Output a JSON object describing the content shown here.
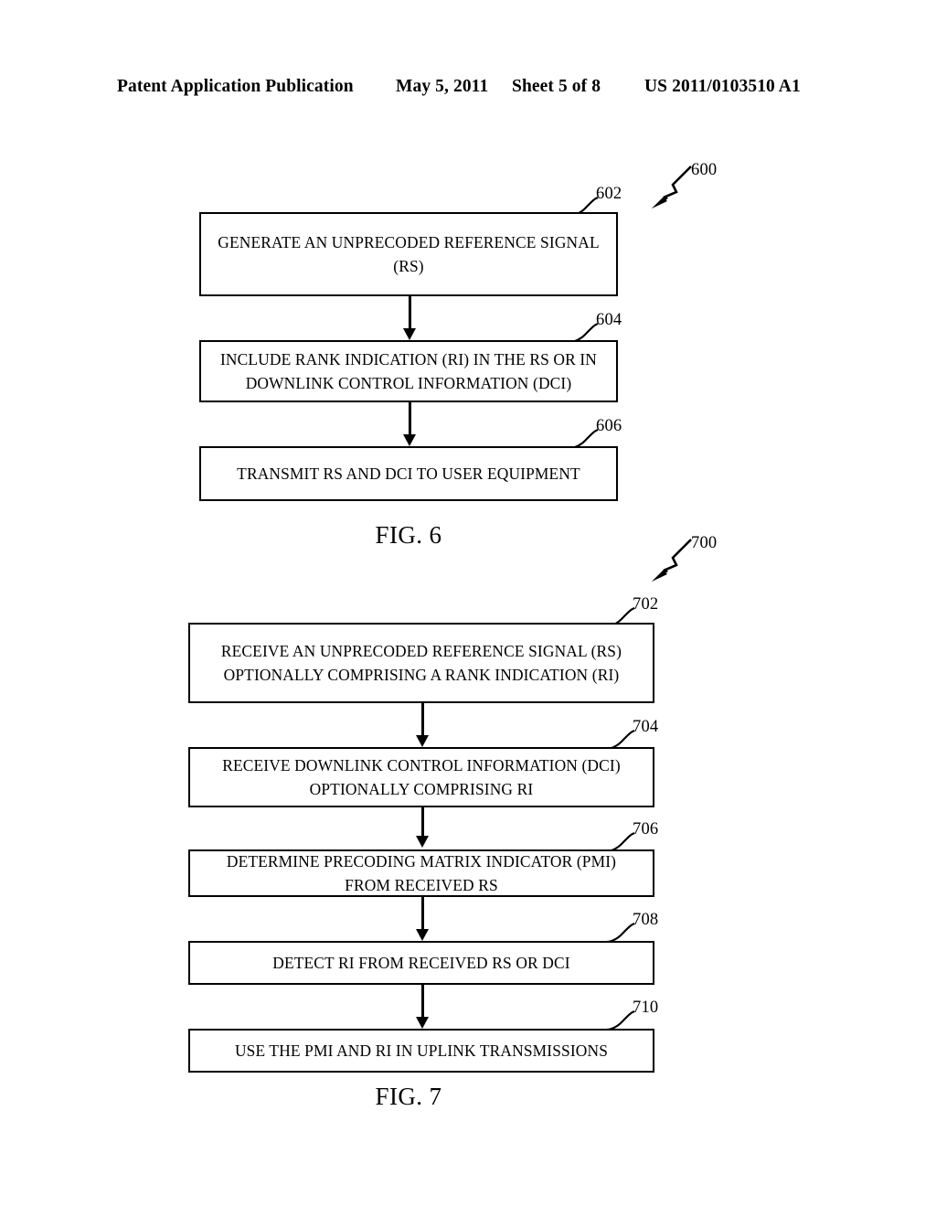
{
  "header": {
    "publication": "Patent Application Publication",
    "date": "May 5, 2011",
    "sheet": "Sheet 5 of 8",
    "number": "US 2011/0103510 A1"
  },
  "figures": [
    {
      "id": "fig6",
      "caption": "FIG. 6",
      "callout": "600",
      "steps": [
        {
          "ref": "602",
          "text": "GENERATE AN UNPRECODED REFERENCE SIGNAL\n(RS)"
        },
        {
          "ref": "604",
          "text": "INCLUDE RANK INDICATION (RI) IN THE RS OR IN\nDOWNLINK CONTROL INFORMATION (DCI)"
        },
        {
          "ref": "606",
          "text": "TRANSMIT RS AND DCI TO USER EQUIPMENT"
        }
      ]
    },
    {
      "id": "fig7",
      "caption": "FIG. 7",
      "callout": "700",
      "steps": [
        {
          "ref": "702",
          "text": "RECEIVE AN UNPRECODED REFERENCE SIGNAL (RS)\nOPTIONALLY COMPRISING A RANK INDICATION (RI)"
        },
        {
          "ref": "704",
          "text": "RECEIVE DOWNLINK CONTROL INFORMATION (DCI)\nOPTIONALLY COMPRISING RI"
        },
        {
          "ref": "706",
          "text": "DETERMINE PRECODING MATRIX INDICATOR (PMI)\nFROM RECEIVED RS"
        },
        {
          "ref": "708",
          "text": "DETECT RI FROM RECEIVED RS OR DCI"
        },
        {
          "ref": "710",
          "text": "USE THE PMI AND RI IN UPLINK TRANSMISSIONS"
        }
      ]
    }
  ]
}
